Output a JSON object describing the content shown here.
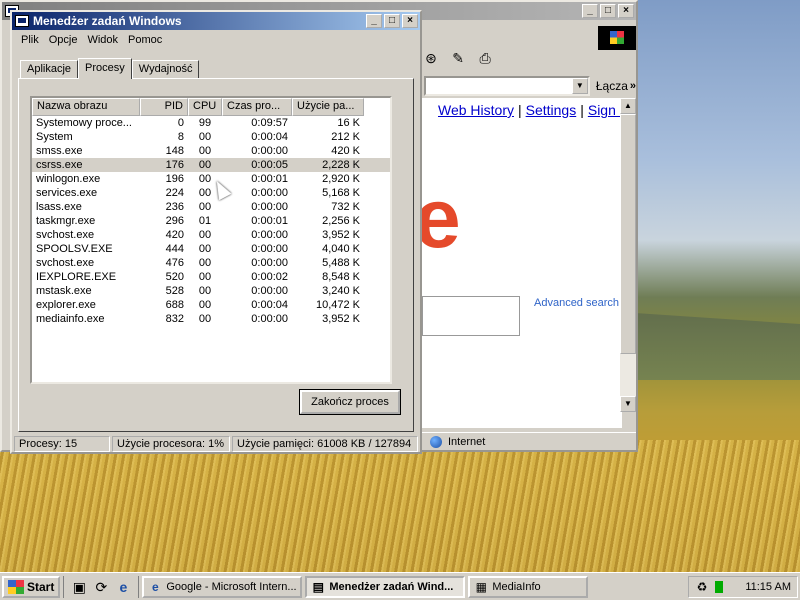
{
  "ie": {
    "links": [
      "Web History",
      "Settings",
      "Sign in"
    ],
    "go_label": "Łącza",
    "chevron": "»",
    "advanced_search": "Advanced search",
    "status_zone": "Internet"
  },
  "task_manager": {
    "title": "Menedżer zadań Windows",
    "menu": [
      "Plik",
      "Opcje",
      "Widok",
      "Pomoc"
    ],
    "tabs": [
      "Aplikacje",
      "Procesy",
      "Wydajność"
    ],
    "active_tab": "Procesy",
    "columns": [
      "Nazwa obrazu",
      "PID",
      "CPU",
      "Czas pro...",
      "Użycie pa..."
    ],
    "processes": [
      {
        "name": "Systemowy proce...",
        "pid": "0",
        "cpu": "99",
        "time": "0:09:57",
        "mem": "16 K"
      },
      {
        "name": "System",
        "pid": "8",
        "cpu": "00",
        "time": "0:00:04",
        "mem": "212 K"
      },
      {
        "name": "smss.exe",
        "pid": "148",
        "cpu": "00",
        "time": "0:00:00",
        "mem": "420 K"
      },
      {
        "name": "csrss.exe",
        "pid": "176",
        "cpu": "00",
        "time": "0:00:05",
        "mem": "2,228 K"
      },
      {
        "name": "winlogon.exe",
        "pid": "196",
        "cpu": "00",
        "time": "0:00:01",
        "mem": "2,920 K"
      },
      {
        "name": "services.exe",
        "pid": "224",
        "cpu": "00",
        "time": "0:00:00",
        "mem": "5,168 K"
      },
      {
        "name": "lsass.exe",
        "pid": "236",
        "cpu": "00",
        "time": "0:00:00",
        "mem": "732 K"
      },
      {
        "name": "taskmgr.exe",
        "pid": "296",
        "cpu": "01",
        "time": "0:00:01",
        "mem": "2,256 K"
      },
      {
        "name": "svchost.exe",
        "pid": "420",
        "cpu": "00",
        "time": "0:00:00",
        "mem": "3,952 K"
      },
      {
        "name": "SPOOLSV.EXE",
        "pid": "444",
        "cpu": "00",
        "time": "0:00:00",
        "mem": "4,040 K"
      },
      {
        "name": "svchost.exe",
        "pid": "476",
        "cpu": "00",
        "time": "0:00:00",
        "mem": "5,488 K"
      },
      {
        "name": "IEXPLORE.EXE",
        "pid": "520",
        "cpu": "00",
        "time": "0:00:02",
        "mem": "8,548 K"
      },
      {
        "name": "mstask.exe",
        "pid": "528",
        "cpu": "00",
        "time": "0:00:00",
        "mem": "3,240 K"
      },
      {
        "name": "explorer.exe",
        "pid": "688",
        "cpu": "00",
        "time": "0:00:04",
        "mem": "10,472 K"
      },
      {
        "name": "mediainfo.exe",
        "pid": "832",
        "cpu": "00",
        "time": "0:00:00",
        "mem": "3,952 K"
      }
    ],
    "selected_row": 3,
    "end_process_label": "Zakończ proces",
    "status": {
      "processes": "Procesy: 15",
      "cpu": "Użycie procesora: 1%",
      "memory": "Użycie pamięci: 61008 KB / 127894"
    }
  },
  "taskbar": {
    "start_label": "Start",
    "tasks": [
      {
        "label": "Google - Microsoft Intern...",
        "icon": "ie-icon",
        "active": false
      },
      {
        "label": "Menedżer zadań Wind...",
        "icon": "taskmgr-icon",
        "active": true
      },
      {
        "label": "MediaInfo",
        "icon": "mediainfo-icon",
        "active": false
      }
    ],
    "clock": "11:15 AM"
  },
  "colors": {
    "title_active": "#0a246a",
    "title_inactive": "#808080",
    "face": "#d4d0c8",
    "link": "#0000cc",
    "logo_red": "#e54a2b"
  }
}
